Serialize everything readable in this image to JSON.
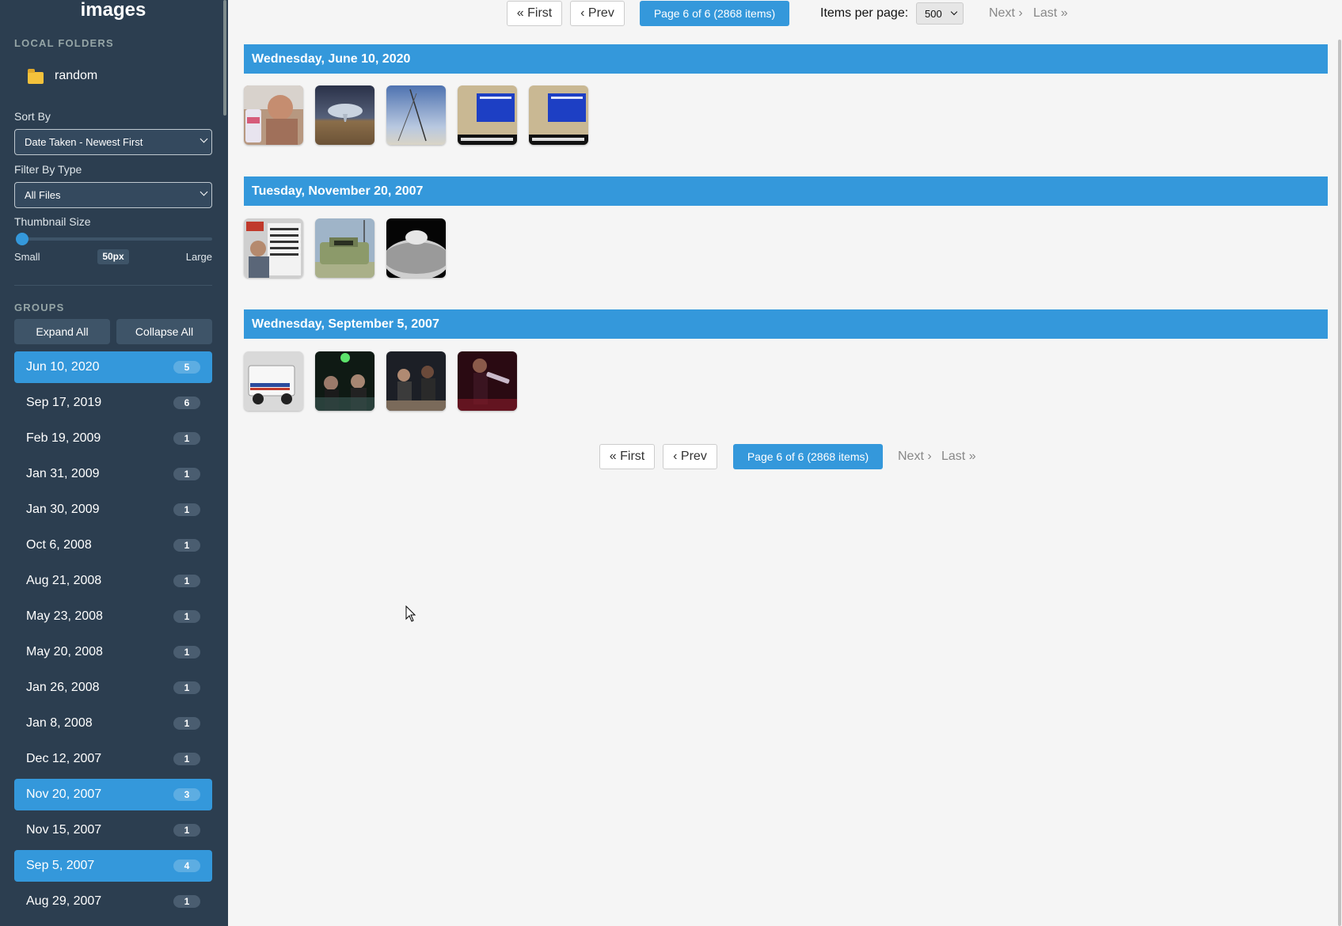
{
  "sidebar": {
    "title": "images",
    "local_folders_label": "LOCAL FOLDERS",
    "folder": {
      "name": "random",
      "icon": "folder-icon"
    },
    "sort_by": {
      "label": "Sort By",
      "value": "Date Taken - Newest First"
    },
    "filter_by_type": {
      "label": "Filter By Type",
      "value": "All Files"
    },
    "thumbnail_size": {
      "label": "Thumbnail Size",
      "min_label": "Small",
      "max_label": "Large",
      "value": "50px",
      "level_fraction": 0
    },
    "groups_label": "GROUPS",
    "expand_all": "Expand All",
    "collapse_all": "Collapse All",
    "groups": [
      {
        "date": "Jun 10, 2020",
        "count": "5",
        "active": true
      },
      {
        "date": "Sep 17, 2019",
        "count": "6",
        "active": false
      },
      {
        "date": "Feb 19, 2009",
        "count": "1",
        "active": false
      },
      {
        "date": "Jan 31, 2009",
        "count": "1",
        "active": false
      },
      {
        "date": "Jan 30, 2009",
        "count": "1",
        "active": false
      },
      {
        "date": "Oct 6, 2008",
        "count": "1",
        "active": false
      },
      {
        "date": "Aug 21, 2008",
        "count": "1",
        "active": false
      },
      {
        "date": "May 23, 2008",
        "count": "1",
        "active": false
      },
      {
        "date": "May 20, 2008",
        "count": "1",
        "active": false
      },
      {
        "date": "Jan 26, 2008",
        "count": "1",
        "active": false
      },
      {
        "date": "Jan 8, 2008",
        "count": "1",
        "active": false
      },
      {
        "date": "Dec 12, 2007",
        "count": "1",
        "active": false
      },
      {
        "date": "Nov 20, 2007",
        "count": "3",
        "active": true
      },
      {
        "date": "Nov 15, 2007",
        "count": "1",
        "active": false
      },
      {
        "date": "Sep 5, 2007",
        "count": "4",
        "active": true
      },
      {
        "date": "Aug 29, 2007",
        "count": "1",
        "active": false
      }
    ]
  },
  "pagination": {
    "first": "« First",
    "prev": "‹ Prev",
    "current": "Page 6 of 6 (2868 items)",
    "next": "Next ›",
    "last": "Last »",
    "items_per_page_label": "Items per page:",
    "items_per_page_value": "500"
  },
  "date_groups": [
    {
      "header": "Wednesday, June 10, 2020",
      "thumbnails": [
        "man-with-can",
        "tornado-storm",
        "blue-sky-antenna",
        "computer-screen",
        "computer-screen-2"
      ]
    },
    {
      "header": "Tuesday, November 20, 2007",
      "thumbnails": [
        "newspaper-man",
        "military-vehicle",
        "moon-earth"
      ]
    },
    {
      "header": "Wednesday, September 5, 2007",
      "thumbnails": [
        "mail-truck",
        "band-stage",
        "band-guitarists",
        "guitarist-red"
      ]
    }
  ],
  "colors": {
    "sidebar_bg": "#2c3e50",
    "accent": "#3498db",
    "main_bg": "#f5f5f5"
  }
}
